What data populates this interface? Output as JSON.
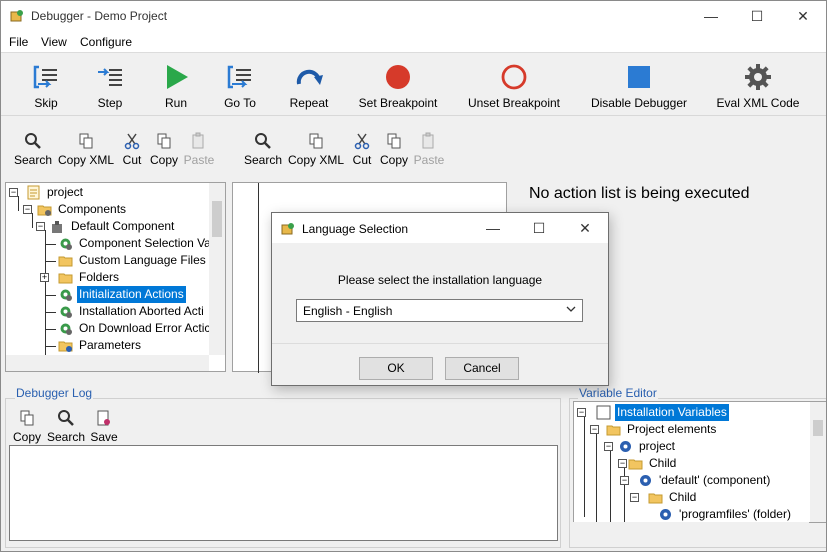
{
  "window": {
    "title": "Debugger - Demo Project",
    "controls": {
      "minimize": "—",
      "maximize": "☐",
      "close": "✕"
    }
  },
  "menu": [
    "File",
    "View",
    "Configure"
  ],
  "toolbar": [
    {
      "label": "Skip",
      "icon": "skip-icon"
    },
    {
      "label": "Step",
      "icon": "step-icon"
    },
    {
      "label": "Run",
      "icon": "run-icon"
    },
    {
      "label": "Go To",
      "icon": "goto-icon"
    },
    {
      "label": "Repeat",
      "icon": "repeat-icon"
    },
    {
      "label": "Set Breakpoint",
      "icon": "set-breakpoint-icon"
    },
    {
      "label": "Unset Breakpoint",
      "icon": "unset-breakpoint-icon"
    },
    {
      "label": "Disable Debugger",
      "icon": "disable-debugger-icon"
    },
    {
      "label": "Eval XML Code",
      "icon": "gear-icon"
    }
  ],
  "left_toolbar": [
    {
      "label": "Search",
      "enabled": true
    },
    {
      "label": "Copy XML",
      "enabled": true
    },
    {
      "label": "Cut",
      "enabled": true
    },
    {
      "label": "Copy",
      "enabled": true
    },
    {
      "label": "Paste",
      "enabled": false
    }
  ],
  "mid_toolbar": [
    {
      "label": "Search",
      "enabled": true
    },
    {
      "label": "Copy XML",
      "enabled": true
    },
    {
      "label": "Cut",
      "enabled": true
    },
    {
      "label": "Copy",
      "enabled": true
    },
    {
      "label": "Paste",
      "enabled": false
    }
  ],
  "project_tree": [
    {
      "label": "project",
      "icon": "project-icon"
    },
    {
      "label": "Components",
      "icon": "folder-gear-icon"
    },
    {
      "label": "Default Component",
      "icon": "component-icon"
    },
    {
      "label": "Component Selection Va",
      "icon": "gear-icon"
    },
    {
      "label": "Custom Language Files",
      "icon": "folder-icon"
    },
    {
      "label": "Folders",
      "icon": "folder-icon"
    },
    {
      "label": "Initialization Actions",
      "icon": "gear-icon",
      "selected": true
    },
    {
      "label": "Installation Aborted Acti",
      "icon": "gear-icon"
    },
    {
      "label": "On Download Error Actic",
      "icon": "gear-icon"
    },
    {
      "label": "Parameters",
      "icon": "folder-question-icon"
    }
  ],
  "status_message": "No action list is being executed",
  "debugger_log": {
    "title": "Debugger Log",
    "buttons": [
      "Copy",
      "Search",
      "Save"
    ]
  },
  "variable_editor": {
    "title": "Variable Editor",
    "rows": [
      {
        "label": "Installation Variables",
        "selected": true
      },
      {
        "label": "Project elements"
      },
      {
        "label": "project"
      },
      {
        "label": "Child"
      },
      {
        "label": "'default' (component)"
      },
      {
        "label": "Child"
      },
      {
        "label": "'programfiles' (folder)"
      }
    ]
  },
  "dialog": {
    "title": "Language Selection",
    "prompt": "Please select the installation language",
    "selected_language": "English - English",
    "ok_label": "OK",
    "cancel_label": "Cancel",
    "controls": {
      "minimize": "—",
      "maximize": "☐",
      "close": "✕"
    }
  },
  "colors": {
    "selection": "#0078d7",
    "group_title": "#2a60b0",
    "run_green": "#2aa84a",
    "breakpoint_red": "#d63a2a",
    "disable_blue": "#2b7bd3"
  }
}
